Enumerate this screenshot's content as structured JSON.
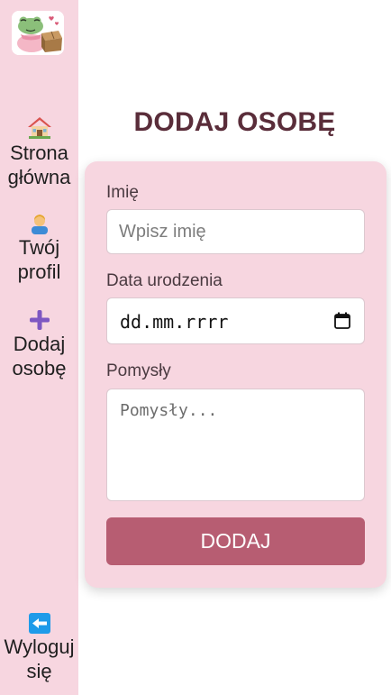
{
  "sidebar": {
    "logo": {
      "icon": "frog-with-box-logo"
    },
    "items": [
      {
        "label": "Strona główna",
        "icon": "house-icon"
      },
      {
        "label": "Twój profil",
        "icon": "person-icon"
      },
      {
        "label": "Dodaj osobę",
        "icon": "plus-icon"
      }
    ],
    "logout": {
      "label": "Wyloguj się",
      "icon": "left-arrow-icon"
    }
  },
  "main": {
    "title": "DODAJ OSOBĘ",
    "form": {
      "name": {
        "label": "Imię",
        "placeholder": "Wpisz imię",
        "value": ""
      },
      "birthdate": {
        "label": "Data urodzenia",
        "placeholder": "dd.mm.rrrr",
        "value": ""
      },
      "ideas": {
        "label": "Pomysły",
        "placeholder": "Pomysły...",
        "value": ""
      },
      "submit_label": "DODAJ"
    }
  },
  "colors": {
    "sidebar_bg": "#f7d6e0",
    "card_bg": "#f7d6e0",
    "title": "#5a2d3a",
    "button": "#b75d72"
  }
}
